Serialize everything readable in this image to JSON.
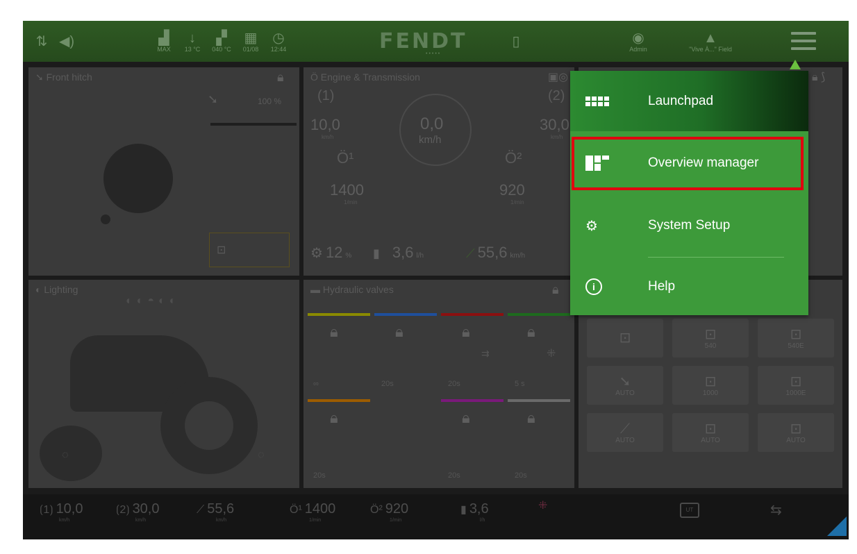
{
  "topbar": {
    "items": [
      {
        "icon": "arrows",
        "label": ""
      },
      {
        "icon": "speaker",
        "label": ""
      },
      {
        "icon": "fuel-tank",
        "label": "MAX"
      },
      {
        "icon": "temperature",
        "label": "13 °C"
      },
      {
        "icon": "tractor",
        "label": "040 °C"
      },
      {
        "icon": "calendar",
        "label": "01/08"
      },
      {
        "icon": "clock",
        "label": "12:44"
      },
      {
        "icon": "phone",
        "label": ""
      },
      {
        "icon": "user",
        "label": "Admin"
      },
      {
        "icon": "field",
        "label": "\"Vive À...\" Field"
      }
    ],
    "logo": "FENDT",
    "logo_sub": "•••••"
  },
  "panels": {
    "front_hitch": {
      "title": "Front hitch",
      "percent": "100 %"
    },
    "engine": {
      "title": "Engine & Transmission",
      "gear1": "1",
      "gear2": "2",
      "speed": "0,0",
      "speed_unit": "km/h",
      "left_val": "10,0",
      "left_unit": "km/h",
      "right_val": "30,0",
      "right_unit": "km/h",
      "rpm1": "1400",
      "rpm1_unit": "1/min",
      "rpm2": "920",
      "rpm2_unit": "1/min",
      "slip": "12",
      "slip_unit": "%",
      "fuel": "3,6",
      "fuel_unit": "l/h",
      "ground_speed": "55,6",
      "ground_unit": "km/h"
    },
    "lighting": {
      "title": "Lighting"
    },
    "hydraulic": {
      "title": "Hydraulic valves",
      "row1_times": [
        "∞",
        "20s",
        "20s",
        "5 s"
      ],
      "row2_times": [
        "20s",
        "20s",
        "20s"
      ],
      "colors": [
        "#8a8a00",
        "#1f4f9c",
        "#8b1010",
        "#1d6a1d",
        "#9c5c00",
        "#7a1a7a",
        "#6a6a6a"
      ]
    },
    "pto": {
      "buttons": [
        {
          "icon": "pto",
          "label": ""
        },
        {
          "icon": "pto",
          "label": "540"
        },
        {
          "icon": "pto",
          "label": "540E"
        },
        {
          "icon": "hitch",
          "label": "AUTO"
        },
        {
          "icon": "pto",
          "label": "1000"
        },
        {
          "icon": "pto",
          "label": "1000E"
        },
        {
          "icon": "hitch-rear",
          "label": "AUTO"
        },
        {
          "icon": "pto-auto-left",
          "label": "AUTO"
        },
        {
          "icon": "pto-auto-right",
          "label": "AUTO"
        }
      ]
    }
  },
  "bottombar": {
    "items": [
      {
        "icon": "gear-1",
        "value": "10,0",
        "unit": "km/h"
      },
      {
        "icon": "gear-2",
        "value": "30,0",
        "unit": "km/h"
      },
      {
        "icon": "ground-speed",
        "value": "55,6",
        "unit": "km/h"
      },
      {
        "icon": "engine-1",
        "value": "1400",
        "unit": "1/min"
      },
      {
        "icon": "engine-2",
        "value": "920",
        "unit": "1/min"
      },
      {
        "icon": "fuel",
        "value": "3,6",
        "unit": "l/h"
      }
    ]
  },
  "menu": {
    "items": [
      {
        "label": "Launchpad",
        "icon": "grid"
      },
      {
        "label": "Overview manager",
        "icon": "overview"
      },
      {
        "label": "System Setup",
        "icon": "gears"
      },
      {
        "label": "Help",
        "icon": "info"
      }
    ],
    "colors": {
      "menu_bg": "#3d9a3a",
      "highlight": "#e0000f"
    }
  }
}
